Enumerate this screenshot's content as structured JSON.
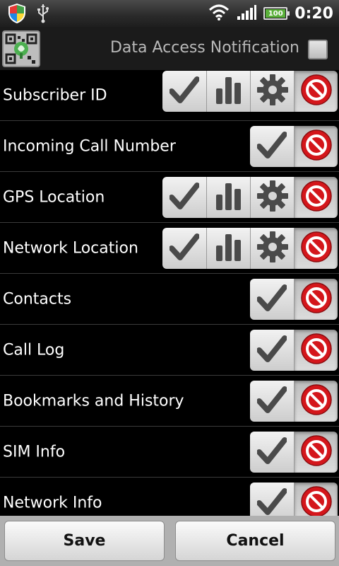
{
  "status_bar": {
    "time": "0:20",
    "battery_level": "100",
    "battery_fraction": 1.0
  },
  "header": {
    "notification_label": "Data Access Notification",
    "notification_checked": false
  },
  "rows": [
    {
      "label": "Subscriber ID",
      "buttons": [
        "allow",
        "fake",
        "custom",
        "deny"
      ],
      "selected": "deny"
    },
    {
      "label": "Incoming Call Number",
      "buttons": [
        "allow",
        "deny"
      ],
      "selected": "deny"
    },
    {
      "label": "GPS Location",
      "buttons": [
        "allow",
        "fake",
        "custom",
        "deny"
      ],
      "selected": "deny"
    },
    {
      "label": "Network Location",
      "buttons": [
        "allow",
        "fake",
        "custom",
        "deny"
      ],
      "selected": "deny"
    },
    {
      "label": "Contacts",
      "buttons": [
        "allow",
        "deny"
      ],
      "selected": "deny"
    },
    {
      "label": "Call Log",
      "buttons": [
        "allow",
        "deny"
      ],
      "selected": "deny"
    },
    {
      "label": "Bookmarks and History",
      "buttons": [
        "allow",
        "deny"
      ],
      "selected": "deny"
    },
    {
      "label": "SIM Info",
      "buttons": [
        "allow",
        "deny"
      ],
      "selected": "deny"
    },
    {
      "label": "Network Info",
      "buttons": [
        "allow",
        "deny"
      ],
      "selected": "deny"
    }
  ],
  "icons": {
    "allow": "check-icon",
    "fake": "bar-chart-icon",
    "custom": "gear-icon",
    "deny": "no-entry-icon"
  },
  "colors": {
    "deny_red": "#d4161b",
    "icon_gray": "#4a4a4a"
  },
  "footer": {
    "save_label": "Save",
    "cancel_label": "Cancel"
  }
}
